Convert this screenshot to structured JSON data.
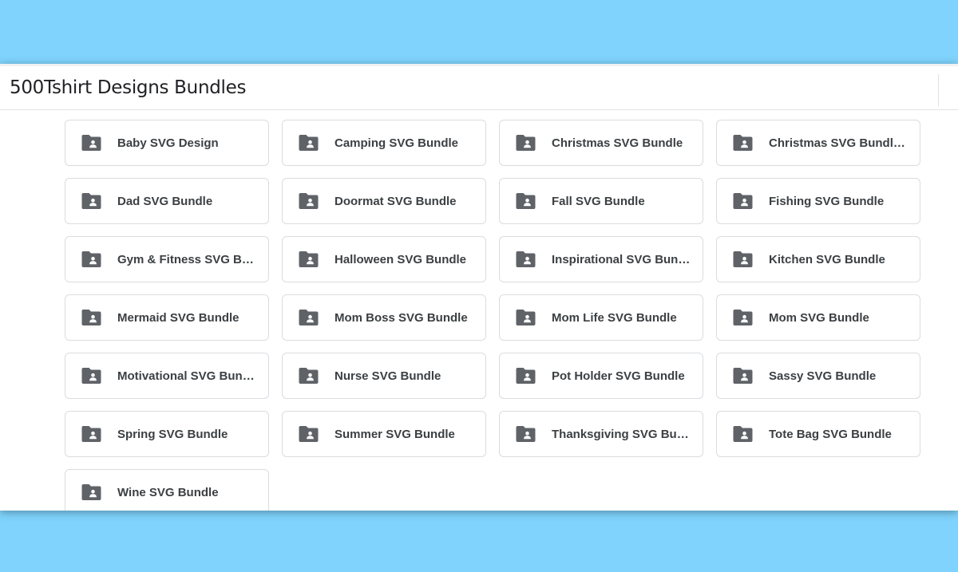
{
  "header": {
    "title": "500Tshirt Designs Bundles"
  },
  "folders": [
    {
      "label": "Baby SVG Design",
      "icon": "shared-folder-icon"
    },
    {
      "label": "Camping SVG Bundle",
      "icon": "shared-folder-icon"
    },
    {
      "label": "Christmas SVG Bundle",
      "icon": "shared-folder-icon"
    },
    {
      "label": "Christmas SVG Bundle V...",
      "icon": "shared-folder-icon"
    },
    {
      "label": "Dad SVG Bundle",
      "icon": "shared-folder-icon"
    },
    {
      "label": "Doormat SVG Bundle",
      "icon": "shared-folder-icon"
    },
    {
      "label": "Fall SVG Bundle",
      "icon": "shared-folder-icon"
    },
    {
      "label": "Fishing SVG Bundle",
      "icon": "shared-folder-icon"
    },
    {
      "label": "Gym & Fitness SVG Bun...",
      "icon": "shared-folder-icon"
    },
    {
      "label": "Halloween SVG Bundle",
      "icon": "shared-folder-icon"
    },
    {
      "label": "Inspirational SVG Bundle...",
      "icon": "shared-folder-icon"
    },
    {
      "label": "Kitchen SVG Bundle",
      "icon": "shared-folder-icon"
    },
    {
      "label": "Mermaid SVG Bundle",
      "icon": "shared-folder-icon"
    },
    {
      "label": "Mom Boss SVG Bundle",
      "icon": "shared-folder-icon"
    },
    {
      "label": "Mom Life SVG Bundle",
      "icon": "shared-folder-icon"
    },
    {
      "label": "Mom SVG Bundle",
      "icon": "shared-folder-icon"
    },
    {
      "label": "Motivational SVG Bundle",
      "icon": "shared-folder-icon"
    },
    {
      "label": "Nurse SVG Bundle",
      "icon": "shared-folder-icon"
    },
    {
      "label": "Pot Holder SVG Bundle",
      "icon": "shared-folder-icon"
    },
    {
      "label": "Sassy SVG Bundle",
      "icon": "shared-folder-icon"
    },
    {
      "label": "Spring SVG Bundle",
      "icon": "shared-folder-icon"
    },
    {
      "label": "Summer SVG Bundle",
      "icon": "shared-folder-icon"
    },
    {
      "label": "Thanksgiving SVG Bundle",
      "icon": "shared-folder-icon"
    },
    {
      "label": "Tote Bag SVG Bundle",
      "icon": "shared-folder-icon"
    },
    {
      "label": "Wine SVG Bundle",
      "icon": "shared-folder-icon"
    }
  ],
  "colors": {
    "background": "#7fd3fc",
    "icon": "#5f6368",
    "text": "#3c4043",
    "border": "#dadce0"
  }
}
